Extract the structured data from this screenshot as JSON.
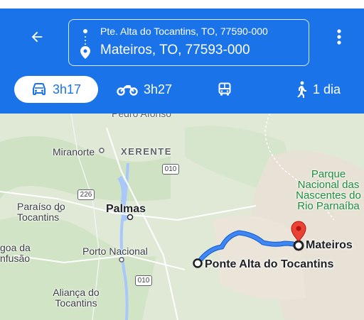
{
  "header": {
    "origin": "Pte. Alta do Tocantins, TO, 77590-000",
    "destination": "Mateiros, TO, 77593-000"
  },
  "modes": [
    {
      "name": "car",
      "label": "3h17",
      "active": true
    },
    {
      "name": "motorcycle",
      "label": "3h27",
      "active": false
    },
    {
      "name": "transit",
      "label": "",
      "active": false
    },
    {
      "name": "walk",
      "label": "1 dia",
      "active": false
    }
  ],
  "map": {
    "labels": {
      "pedro_afonso": "Pedro Afonso",
      "miranorte": "Miranorte",
      "xerente": "XERENTE",
      "paraiso": "Paraíso do Tocantins",
      "palmas": "Palmas",
      "lagoa": "goa da nfusão",
      "porto_nacional": "Porto Nacional",
      "alianca": "Aliança do Tocantins",
      "parque": "Parque Nacional das Nascentes do Rio Parnaíba",
      "mateiros": "Mateiros",
      "ponte_alta": "Ponte Alta do Tocantins"
    },
    "roads": {
      "r010_top": "010",
      "r226": "226",
      "r010_bottom": "010"
    }
  },
  "colors": {
    "header_bg": "#1a73e8",
    "route": "#4285f4",
    "pin": "#ea4335",
    "park_text": "#1e8e3e"
  }
}
